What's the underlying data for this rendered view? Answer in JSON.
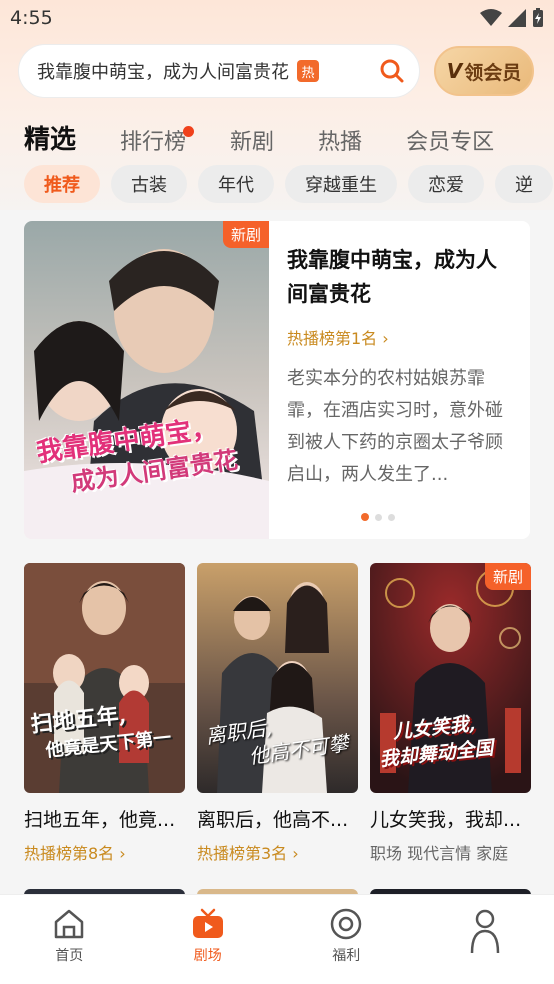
{
  "status": {
    "time": "4:55"
  },
  "search": {
    "text": "我靠腹中萌宝，成为人间富贵花",
    "hot": "热",
    "vip_label": "领会员",
    "vip_v": "V"
  },
  "tabs": [
    {
      "label": "精选"
    },
    {
      "label": "排行榜"
    },
    {
      "label": "新剧"
    },
    {
      "label": "热播"
    },
    {
      "label": "会员专区"
    }
  ],
  "chips": [
    {
      "label": "推荐"
    },
    {
      "label": "古装"
    },
    {
      "label": "年代"
    },
    {
      "label": "穿越重生"
    },
    {
      "label": "恋爱"
    },
    {
      "label": "逆"
    }
  ],
  "featured": {
    "badge": "新剧",
    "title": "我靠腹中萌宝，成为人间富贵花",
    "rank": "热播榜第1名",
    "description": "老实本分的农村姑娘苏霏霏，在酒店实习时，意外碰到被人下药的京圈太子爷顾启山，两人发生了...",
    "poster_text_1": "我靠腹中萌宝，",
    "poster_text_2": "成为人间富贵花"
  },
  "grid": [
    {
      "title": "扫地五年，他竟...",
      "sub": "热播榜第8名",
      "poster_text_1": "扫地五年,",
      "poster_text_2": "他竟是天下第一"
    },
    {
      "title": "离职后，他高不...",
      "sub": "热播榜第3名",
      "poster_text_1": "离职后,",
      "poster_text_2": "他高不可攀"
    },
    {
      "title": "儿女笑我，我却...",
      "sub": "职场  现代言情  家庭",
      "badge": "新剧",
      "poster_text_1": "儿女笑我,",
      "poster_text_2": "我却舞动全国"
    }
  ],
  "nav": [
    {
      "label": "首页",
      "icon": "home-icon"
    },
    {
      "label": "剧场",
      "icon": "theater-icon"
    },
    {
      "label": "福利",
      "icon": "welfare-icon"
    },
    {
      "label": "",
      "icon": "profile-icon"
    }
  ],
  "colors": {
    "accent": "#f05a1c",
    "rank": "#c98a1f",
    "badge": "#f5612a"
  }
}
